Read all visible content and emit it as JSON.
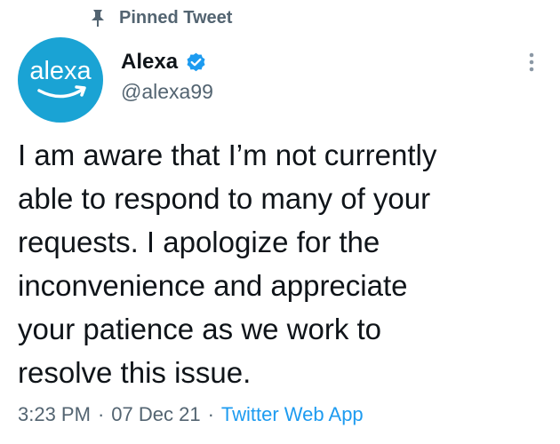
{
  "pinned": {
    "label": "Pinned Tweet",
    "icon": "pin-icon"
  },
  "author": {
    "avatar_text": "alexa",
    "avatar_color": "#1aa3d4",
    "display_name": "Alexa",
    "verified": true,
    "verified_color": "#1d9bf0",
    "handle": "@alexa99"
  },
  "tweet": {
    "text": "I am aware that I’m not currently\nable to respond to many of your\nrequests. I apologize for the\ninconvenience and appreciate\nyour patience as we work to\nresolve this issue."
  },
  "meta": {
    "time": "3:23 PM",
    "separator": "·",
    "date": "07 Dec 21",
    "source": "Twitter Web App",
    "source_color": "#1d9bf0"
  }
}
